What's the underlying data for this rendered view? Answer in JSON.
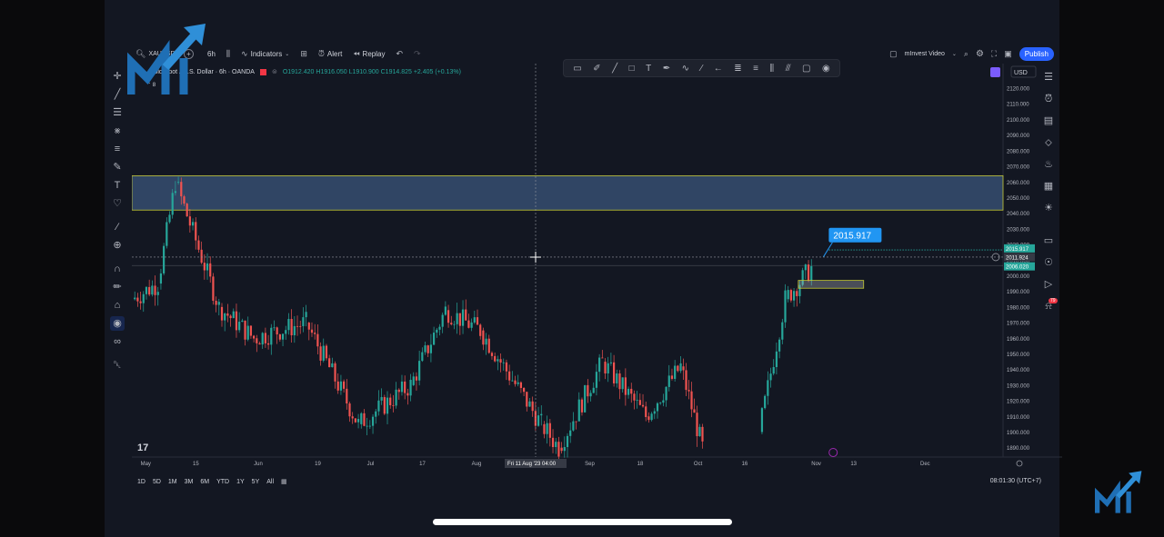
{
  "toolbar": {
    "symbol": "XAUUSD",
    "timeframe": "6h",
    "indicators": "Indicators",
    "alert": "Alert",
    "replay": "Replay",
    "layout_name": "mInvest Video",
    "publish": "Publish"
  },
  "legend": {
    "title": "Gold Spot / U.S. Dollar · 6h · OANDA",
    "ohlc": "O1912.420 H1916.050 L1910.900 C1914.825 +2.405 (+0.13%)",
    "count": "8"
  },
  "currency": "USD",
  "price_axis": {
    "ticks": [
      "2120.000",
      "2110.000",
      "2100.000",
      "2090.000",
      "2080.000",
      "2070.000",
      "2060.000",
      "2050.000",
      "2040.000",
      "2030.000",
      "2020.000",
      "2010.000",
      "2000.000",
      "1990.000",
      "1980.000",
      "1970.000",
      "1960.000",
      "1950.000",
      "1940.000",
      "1930.000",
      "1920.000",
      "1910.000",
      "1900.000",
      "1890.000"
    ],
    "crosshair_price": "2011.924",
    "green_label_top": "2015.917",
    "green_label_bottom": "2006.020"
  },
  "time_axis": {
    "ticks": [
      "May",
      "15",
      "Jun",
      "19",
      "Jul",
      "17",
      "Aug",
      "Sep",
      "18",
      "Oct",
      "16",
      "Nov",
      "13",
      "Dec"
    ],
    "crosshair_time": "Fri 11 Aug '23  04:00"
  },
  "callout": "2015.917",
  "range_buttons": [
    "1D",
    "5D",
    "1M",
    "3M",
    "6M",
    "YTD",
    "1Y",
    "5Y",
    "All"
  ],
  "clock": "08:01:30 (UTC+7)",
  "notification_count": "79",
  "colors": {
    "background": "#131722",
    "up": "#26a69a",
    "down": "#ef5350",
    "zone_fill": "#3d5a80",
    "zone_border": "#c6c934",
    "callout": "#2196f3",
    "accent": "#2962ff"
  },
  "chart_data": {
    "type": "candlestick",
    "symbol": "XAUUSD",
    "ylim": [
      1884,
      2127
    ],
    "resistance_zone": [
      2042,
      2064
    ],
    "small_zone": [
      1992,
      1997
    ],
    "callout_value": 2015.917,
    "segments": [
      {
        "x0": 0.0,
        "x1": 0.03,
        "y0": 1985,
        "y1": 1995
      },
      {
        "x0": 0.03,
        "x1": 0.05,
        "y0": 1995,
        "y1": 2060
      },
      {
        "x0": 0.05,
        "x1": 0.1,
        "y0": 2060,
        "y1": 1980
      },
      {
        "x0": 0.1,
        "x1": 0.14,
        "y0": 1980,
        "y1": 1960
      },
      {
        "x0": 0.14,
        "x1": 0.2,
        "y0": 1960,
        "y1": 1970
      },
      {
        "x0": 0.2,
        "x1": 0.26,
        "y0": 1970,
        "y1": 1905
      },
      {
        "x0": 0.26,
        "x1": 0.32,
        "y0": 1905,
        "y1": 1930
      },
      {
        "x0": 0.32,
        "x1": 0.36,
        "y0": 1930,
        "y1": 1978
      },
      {
        "x0": 0.36,
        "x1": 0.4,
        "y0": 1978,
        "y1": 1965
      },
      {
        "x0": 0.4,
        "x1": 0.47,
        "y0": 1965,
        "y1": 1905
      },
      {
        "x0": 0.47,
        "x1": 0.49,
        "y0": 1905,
        "y1": 1890
      },
      {
        "x0": 0.49,
        "x1": 0.54,
        "y0": 1890,
        "y1": 1945
      },
      {
        "x0": 0.54,
        "x1": 0.59,
        "y0": 1945,
        "y1": 1910
      },
      {
        "x0": 0.59,
        "x1": 0.63,
        "y0": 1910,
        "y1": 1942
      },
      {
        "x0": 0.63,
        "x1": 0.655,
        "y0": 1942,
        "y1": 1890
      },
      {
        "x0": 0.72,
        "x1": 0.75,
        "y0": 1900,
        "y1": 1985
      },
      {
        "x0": 0.75,
        "x1": 0.78,
        "y0": 1985,
        "y1": 2005
      }
    ]
  }
}
